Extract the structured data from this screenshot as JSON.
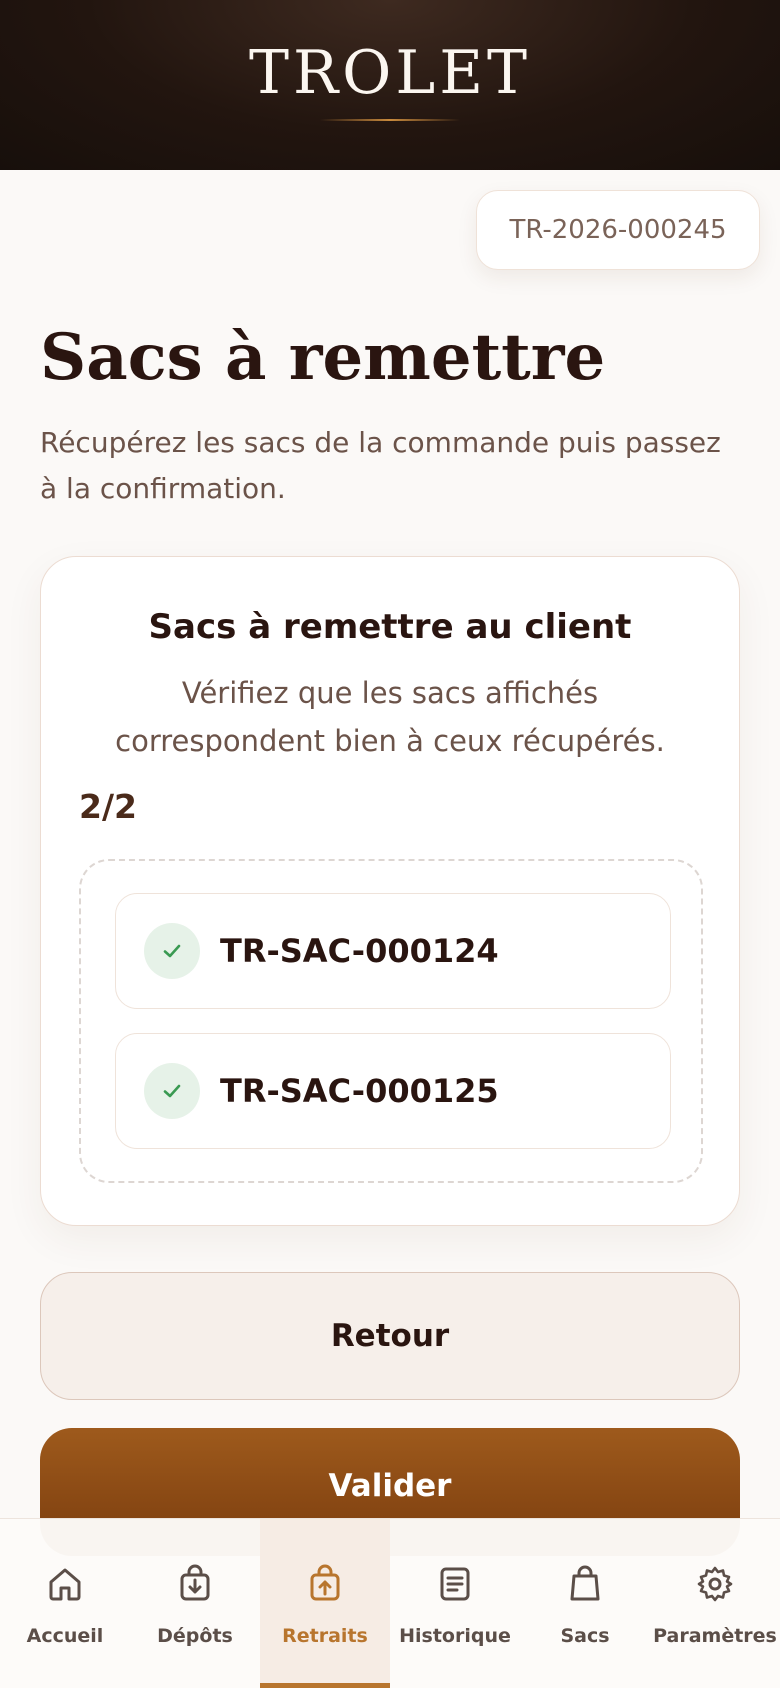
{
  "header": {
    "brand": "TROLET"
  },
  "order": {
    "reference": "TR-2026-000245"
  },
  "page": {
    "title": "Sacs à remettre",
    "subtitle": "Récupérez les sacs de la commande puis passez à la confirmation."
  },
  "card": {
    "title": "Sacs à remettre au client",
    "description": "Vérifiez que les sacs affichés correspondent bien à ceux récupérés.",
    "counter": "2/2",
    "bags": [
      {
        "code": "TR-SAC-000124",
        "status_icon": "check-icon"
      },
      {
        "code": "TR-SAC-000125",
        "status_icon": "check-icon"
      }
    ]
  },
  "actions": {
    "back_label": "Retour",
    "validate_label": "Valider"
  },
  "nav": {
    "items": [
      {
        "label": "Accueil",
        "icon": "home-icon"
      },
      {
        "label": "Dépôts",
        "icon": "deposit-bag-icon"
      },
      {
        "label": "Retraits",
        "icon": "withdraw-bag-icon",
        "active": true
      },
      {
        "label": "Historique",
        "icon": "history-icon"
      },
      {
        "label": "Sacs",
        "icon": "bag-icon"
      },
      {
        "label": "Paramètres",
        "icon": "gear-icon"
      }
    ]
  },
  "colors": {
    "accent": "#b8752d",
    "primary_button": "#8a4a14",
    "header_bg": "#1c120d",
    "success": "#3a9a52"
  }
}
